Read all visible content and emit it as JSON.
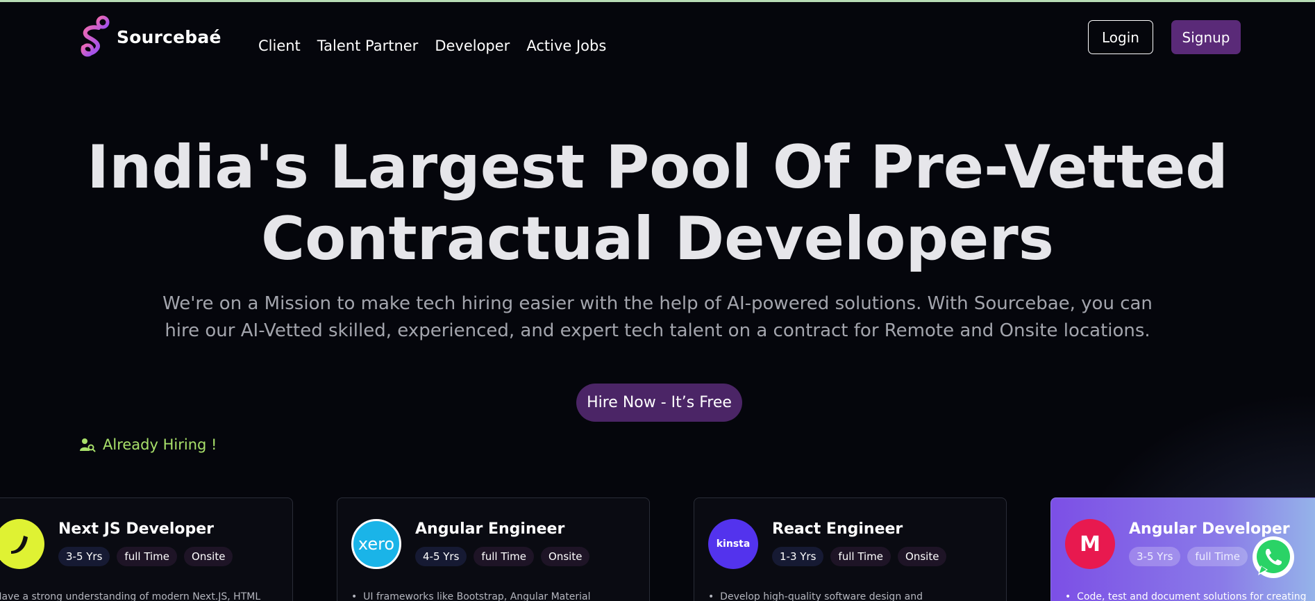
{
  "brand": {
    "name": "Sourcebaé"
  },
  "nav": [
    "Client",
    "Talent Partner",
    "Developer",
    "Active Jobs"
  ],
  "auth": {
    "login_label": "Login",
    "signup_label": "Signup"
  },
  "hero": {
    "title_line1": "India's Largest Pool Of Pre-Vetted",
    "title_line2": "Contractual Developers",
    "subtitle_line1": "We're on a Mission to make tech hiring easier with the help of AI-powered solutions. With Sourcebae, you can",
    "subtitle_line2": "hire our AI-Vetted skilled, experienced, and expert tech talent on a contract for Remote and Onsite locations.",
    "cta_label": "Hire Now - It’s Free"
  },
  "hiring_label": "Already Hiring !",
  "jobs": [
    {
      "title": "Next JS Developer",
      "experience": "3-5 Yrs",
      "type": "full Time",
      "location": "Onsite",
      "description": "Have a strong understanding of modern Next.JS, HTML",
      "logo_color": "#dff233"
    },
    {
      "title": "Angular Engineer",
      "experience": "4-5 Yrs",
      "type": "full Time",
      "location": "Onsite",
      "description": "UI frameworks like Bootstrap, Angular Material",
      "logo_text": "xero",
      "logo_color": "#1ab4e8"
    },
    {
      "title": "React Engineer",
      "experience": "1-3 Yrs",
      "type": "full Time",
      "location": "Onsite",
      "description": "Develop high-quality software design and",
      "logo_text": "kinsta",
      "logo_color": "#5333ed"
    },
    {
      "title": "Angular Developer",
      "experience": "3-5 Yrs",
      "type": "full Time",
      "description": "Code, test and document solutions for creating",
      "logo_text": "M",
      "logo_color": "#e8194f"
    }
  ],
  "colors": {
    "accent": "#5a2a78",
    "cta": "#4b2566",
    "hiring_green": "#a8e06a",
    "background": "#05060c"
  }
}
